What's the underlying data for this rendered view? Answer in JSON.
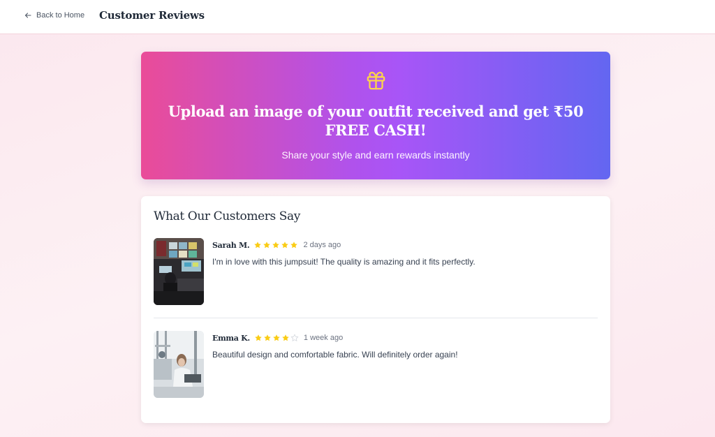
{
  "header": {
    "back_label": "Back to Home",
    "title": "Customer Reviews"
  },
  "promo": {
    "icon": "gift-icon",
    "headline": "Upload an image of your outfit received and get ₹50 FREE CASH!",
    "subtext": "Share your style and earn rewards instantly",
    "gradient": [
      "#ea4c98",
      "#a855f7",
      "#6366f1"
    ],
    "icon_color": "#fcd34d"
  },
  "reviews": {
    "title": "What Our Customers Say",
    "items": [
      {
        "name": "Sarah M.",
        "rating": 5,
        "max_rating": 5,
        "time": "2 days ago",
        "text": "I'm in love with this jumpsuit! The quality is amazing and it fits perfectly."
      },
      {
        "name": "Emma K.",
        "rating": 4,
        "max_rating": 5,
        "time": "1 week ago",
        "text": "Beautiful design and comfortable fabric. Will definitely order again!"
      }
    ],
    "star_color": "#facc15"
  }
}
